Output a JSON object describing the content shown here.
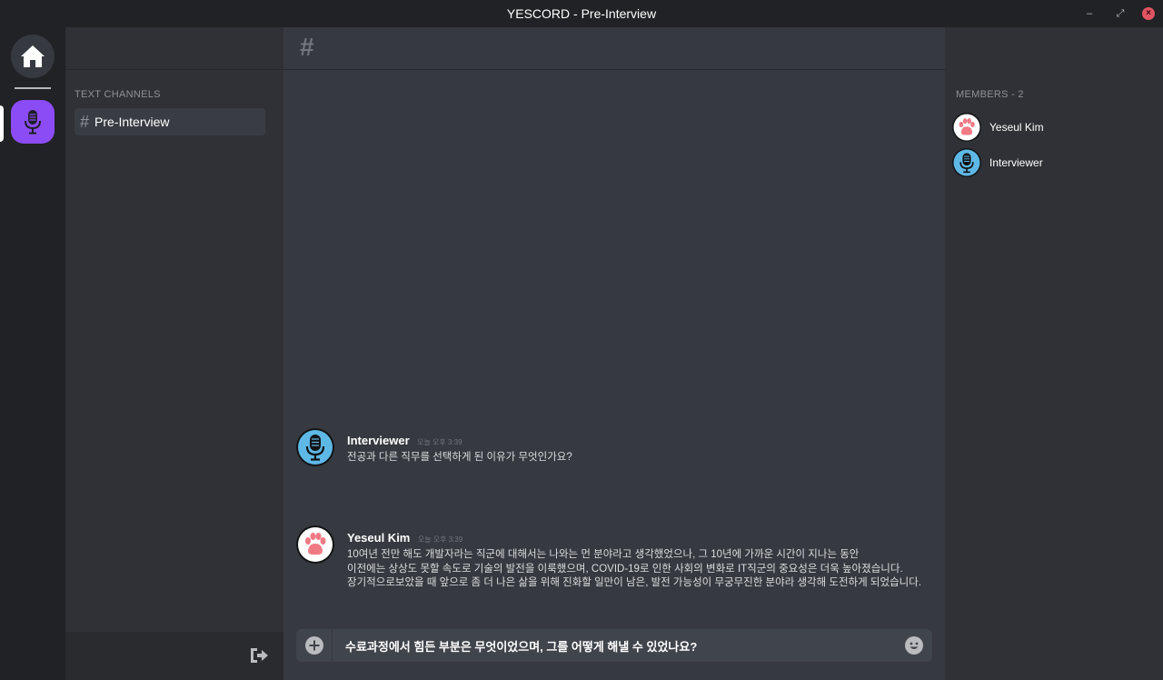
{
  "window": {
    "title": "YESCORD - Pre-Interview",
    "minimize_glyph": "–",
    "maximize_glyph": "⤢",
    "close_glyph": "×"
  },
  "server_rail": {
    "home_icon": "home-icon",
    "servers": [
      {
        "icon": "microphone-icon",
        "color": "#8c4cf5",
        "active": true
      }
    ]
  },
  "channels": {
    "category": "TEXT CHANNELS",
    "items": [
      {
        "hash": "#",
        "name": "Pre-Interview",
        "active": true
      }
    ],
    "footer_icon": "logout-icon"
  },
  "chat": {
    "header_hash": "#",
    "messages": [
      {
        "author": "Interviewer",
        "time": "오늘 오후 3:39",
        "avatar": "microphone-avatar",
        "lines": [
          "전공과 다른 직무를 선택하게 된 이유가 무엇인가요?"
        ]
      },
      {
        "author": "Yeseul Kim",
        "time": "오늘 오후 3:39",
        "avatar": "paw-avatar",
        "lines": [
          "10여년 전만 해도 개발자라는 직군에 대해서는 나와는 먼 분야라고 생각했었으나, 그 10년에 가까운 시간이 지나는 동안",
          "이전에는 상상도 못할 속도로 기술의 발전을 이룩했으며, COVID-19로 인한 사회의 변화로 IT직군의 중요성은 더욱 높아졌습니다.",
          "장기적으로보았을 때 앞으로 좀 더 나은 삶을 위해 진화할 일만이 남은, 발전 가능성이 무궁무진한 분야라 생각해 도전하게 되었습니다."
        ]
      }
    ],
    "composer": {
      "value": "수료과정에서 힘든 부분은 무엇이었으며, 그를 어떻게 해낼 수 있었나요?",
      "plus_icon": "plus-circle-icon",
      "emoji_icon": "emoji-icon"
    }
  },
  "members": {
    "label": "MEMBERS - 2",
    "list": [
      {
        "name": "Yeseul Kim",
        "avatar": "paw-avatar"
      },
      {
        "name": "Interviewer",
        "avatar": "microphone-avatar"
      }
    ]
  },
  "colors": {
    "accent": "#8c4cf5",
    "mic_avatar_bg": "#5eb8e6",
    "paw_pink": "#f07a84",
    "close_button": "#e05561"
  }
}
